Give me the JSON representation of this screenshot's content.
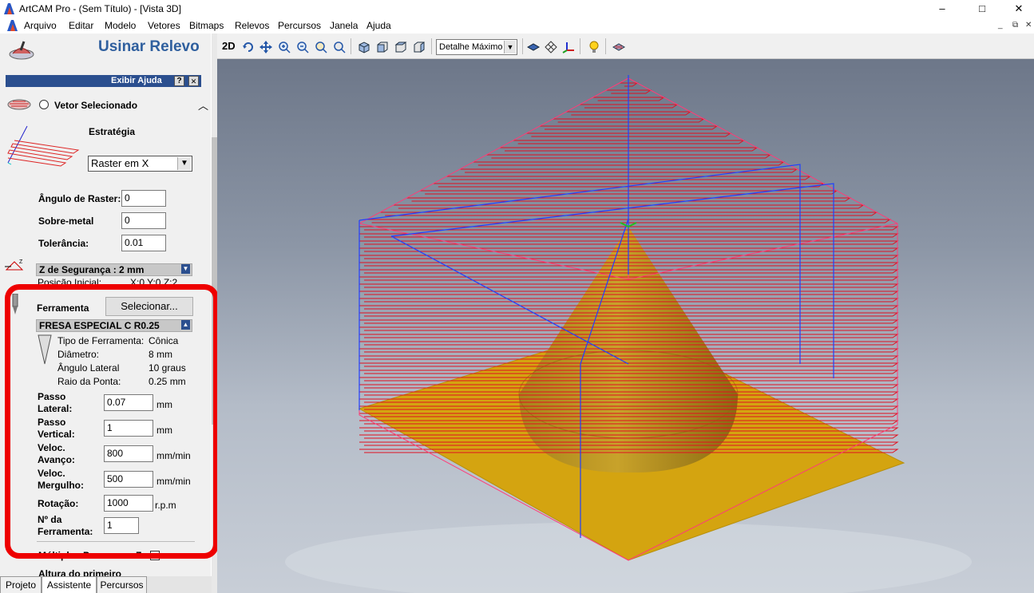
{
  "window": {
    "title": "ArtCAM Pro - (Sem Título) - [Vista 3D]",
    "controls": [
      "–",
      "□",
      "✕"
    ]
  },
  "menu": {
    "items": [
      "Arquivo",
      "Editar",
      "Modelo",
      "Vetores",
      "Bitmaps",
      "Relevos",
      "Percursos",
      "Janela",
      "Ajuda"
    ],
    "mdi_controls": [
      "_",
      "⧉",
      "✕"
    ]
  },
  "panel": {
    "title": "Usinar Relevo",
    "help_label": "Exibir Ajuda",
    "help_q": "?",
    "help_x": "✕",
    "vector_option": "Vetor Selecionado",
    "strategy_label": "Estratégia",
    "strategy_value": "Raster em X",
    "raster_angle_label": "Ângulo de Raster:",
    "raster_angle_value": "0",
    "overmetal_label": "Sobre-metal",
    "overmetal_value": "0",
    "tolerance_label": "Tolerância:",
    "tolerance_value": "0.01",
    "safe_z": "Z de Segurança : 2 mm",
    "home_label": "Posição Inicial:",
    "home_value": "X:0 Y:0 Z:2",
    "tool_label": "Ferramenta",
    "select_button": "Selecionar...",
    "tool_name": "FRESA ESPECIAL C R0.25",
    "tool_props": [
      {
        "label": "Tipo de Ferramenta:",
        "value": "Cônica"
      },
      {
        "label": "Diâmetro:",
        "value": "8 mm"
      },
      {
        "label": "Ângulo Lateral",
        "value": "10 graus"
      },
      {
        "label": "Raio da Ponta:",
        "value": "0.25 mm"
      }
    ],
    "params": [
      {
        "label1": "Passo",
        "label2": "Lateral:",
        "value": "0.07",
        "unit": "mm"
      },
      {
        "label1": "Passo",
        "label2": "Vertical:",
        "value": "1",
        "unit": "mm"
      },
      {
        "label1": "Veloc.",
        "label2": "Avanço:",
        "value": "800",
        "unit": "mm/min"
      },
      {
        "label1": "Veloc.",
        "label2": "Mergulho:",
        "value": "500",
        "unit": "mm/min"
      }
    ],
    "rotation_label": "Rotação:",
    "rotation_value": "1000",
    "rotation_unit": "r.p.m",
    "toolnum_label1": "Nº da",
    "toolnum_label2": "Ferramenta:",
    "toolnum_value": "1",
    "multipass_label": "Múltiplos Passos em Z",
    "first_height_label": "Altura do primeiro"
  },
  "tabs": [
    "Projeto",
    "Assistente",
    "Percursos"
  ],
  "toolbar": {
    "mode_2d": "2D",
    "detail_value": "Detalhe Máximo"
  },
  "icons": [
    "app-logo-icon",
    "relief-machining-icon",
    "vector-icon",
    "strategy-raster-icon",
    "safe-z-icon",
    "tool-icon",
    "cone-tool-icon",
    "rotate-view-icon",
    "pan-icon",
    "zoom-in-icon",
    "zoom-out-icon",
    "zoom-box-icon",
    "zoom-all-icon",
    "view-iso-icon",
    "view-front-icon",
    "view-top-icon",
    "view-side-icon",
    "shade-icon",
    "wireframe-icon",
    "axes-icon",
    "light-icon",
    "toolpath-view-icon"
  ],
  "colors": {
    "annotation": "#ee0000",
    "accent_title": "#2f5f9e",
    "help_bar": "#2b4f8f",
    "toolpath": "#e01020",
    "relief": "#d4a410",
    "bbox": "#ff3c78",
    "boundary": "#2040ff"
  }
}
